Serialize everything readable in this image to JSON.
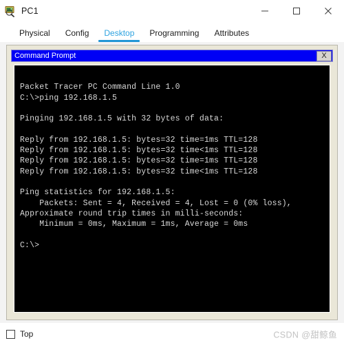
{
  "window": {
    "title": "PC1",
    "icon": "pc-device-icon",
    "controls": {
      "minimize_label": "—",
      "maximize_label": "□",
      "close_label": "✕"
    }
  },
  "tabs": [
    {
      "label": "Physical",
      "active": false
    },
    {
      "label": "Config",
      "active": false
    },
    {
      "label": "Desktop",
      "active": true
    },
    {
      "label": "Programming",
      "active": false
    },
    {
      "label": "Attributes",
      "active": false
    }
  ],
  "command_prompt": {
    "title": "Command Prompt",
    "close_label": "X",
    "lines": [
      "",
      "Packet Tracer PC Command Line 1.0",
      "C:\\>ping 192.168.1.5",
      "",
      "Pinging 192.168.1.5 with 32 bytes of data:",
      "",
      "Reply from 192.168.1.5: bytes=32 time=1ms TTL=128",
      "Reply from 192.168.1.5: bytes=32 time<1ms TTL=128",
      "Reply from 192.168.1.5: bytes=32 time=1ms TTL=128",
      "Reply from 192.168.1.5: bytes=32 time<1ms TTL=128",
      "",
      "Ping statistics for 192.168.1.5:",
      "    Packets: Sent = 4, Received = 4, Lost = 0 (0% loss),",
      "Approximate round trip times in milli-seconds:",
      "    Minimum = 0ms, Maximum = 1ms, Average = 0ms",
      "",
      "C:\\>"
    ]
  },
  "footer": {
    "top_checkbox_label": "Top",
    "top_checkbox_checked": false,
    "watermark": "CSDN @甜鲸鱼"
  },
  "colors": {
    "accent_tab": "#2196d6",
    "cmd_titlebar": "#0000f5",
    "panel_bg": "#eae7d8",
    "terminal_bg": "#000000",
    "terminal_text": "#d8d8d8"
  }
}
